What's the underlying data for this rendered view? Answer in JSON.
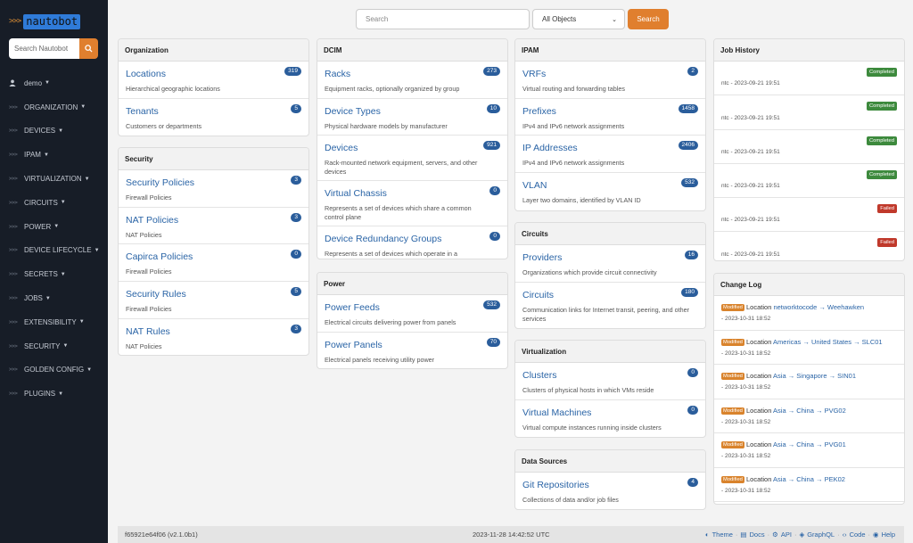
{
  "sidebar": {
    "logo": "nautobot",
    "logo_prefix": ">>>",
    "search_placeholder": "Search Nautobot",
    "user": "demo",
    "items": [
      {
        "label": "ORGANIZATION"
      },
      {
        "label": "DEVICES"
      },
      {
        "label": "IPAM"
      },
      {
        "label": "VIRTUALIZATION"
      },
      {
        "label": "CIRCUITS"
      },
      {
        "label": "POWER"
      },
      {
        "label": "DEVICE LIFECYCLE"
      },
      {
        "label": "SECRETS"
      },
      {
        "label": "JOBS"
      },
      {
        "label": "EXTENSIBILITY"
      },
      {
        "label": "SECURITY"
      },
      {
        "label": "GOLDEN CONFIG"
      },
      {
        "label": "PLUGINS"
      }
    ]
  },
  "search": {
    "placeholder": "Search",
    "scope": "All Objects",
    "button": "Search"
  },
  "organization": {
    "title": "Organization",
    "items": [
      {
        "name": "Locations",
        "desc": "Hierarchical geographic locations",
        "count": "319"
      },
      {
        "name": "Tenants",
        "desc": "Customers or departments",
        "count": "5"
      }
    ]
  },
  "security": {
    "title": "Security",
    "items": [
      {
        "name": "Security Policies",
        "desc": "Firewall Policies",
        "count": "3"
      },
      {
        "name": "NAT Policies",
        "desc": "NAT Policies",
        "count": "3"
      },
      {
        "name": "Capirca Policies",
        "desc": "Firewall Policies",
        "count": "0"
      },
      {
        "name": "Security Rules",
        "desc": "Firewall Policies",
        "count": "5"
      },
      {
        "name": "NAT Rules",
        "desc": "NAT Policies",
        "count": "3"
      }
    ]
  },
  "dcim": {
    "title": "DCIM",
    "items": [
      {
        "name": "Racks",
        "desc": "Equipment racks, optionally organized by group",
        "count": "273"
      },
      {
        "name": "Device Types",
        "desc": "Physical hardware models by manufacturer",
        "count": "10"
      },
      {
        "name": "Devices",
        "desc": "Rack-mounted network equipment, servers, and other devices",
        "count": "921"
      },
      {
        "name": "Virtual Chassis",
        "desc": "Represents a set of devices which share a common control plane",
        "count": "0"
      },
      {
        "name": "Device Redundancy Groups",
        "desc": "Represents a set of devices which operate in a",
        "count": "0"
      }
    ]
  },
  "power": {
    "title": "Power",
    "items": [
      {
        "name": "Power Feeds",
        "desc": "Electrical circuits delivering power from panels",
        "count": "532"
      },
      {
        "name": "Power Panels",
        "desc": "Electrical panels receiving utility power",
        "count": "70"
      }
    ]
  },
  "ipam": {
    "title": "IPAM",
    "items": [
      {
        "name": "VRFs",
        "desc": "Virtual routing and forwarding tables",
        "count": "2"
      },
      {
        "name": "Prefixes",
        "desc": "IPv4 and IPv6 network assignments",
        "count": "1458"
      },
      {
        "name": "IP Addresses",
        "desc": "IPv4 and IPv6 network assignments",
        "count": "2406"
      },
      {
        "name": "VLAN",
        "desc": "Layer two domains, identified by VLAN ID",
        "count": "532"
      }
    ]
  },
  "circuits": {
    "title": "Circuits",
    "items": [
      {
        "name": "Providers",
        "desc": "Organizations which provide circuit connectivity",
        "count": "16"
      },
      {
        "name": "Circuits",
        "desc": "Communication links for Internet transit, peering, and other services",
        "count": "180"
      }
    ]
  },
  "virtualization": {
    "title": "Virtualization",
    "items": [
      {
        "name": "Clusters",
        "desc": "Clusters of physical hosts in which VMs reside",
        "count": "0"
      },
      {
        "name": "Virtual Machines",
        "desc": "Virtual compute instances running inside clusters",
        "count": "0"
      }
    ]
  },
  "data_sources": {
    "title": "Data Sources",
    "items": [
      {
        "name": "Git Repositories",
        "desc": "Collections of data and/or job files",
        "count": "4"
      }
    ]
  },
  "job_history": {
    "title": "Job History",
    "items": [
      {
        "text": "ntc - 2023-09-21 19:51",
        "status": "Completed"
      },
      {
        "text": "ntc - 2023-09-21 19:51",
        "status": "Completed"
      },
      {
        "text": "ntc - 2023-09-21 19:51",
        "status": "Completed"
      },
      {
        "text": "ntc - 2023-09-21 19:51",
        "status": "Completed"
      },
      {
        "text": "ntc - 2023-09-21 19:51",
        "status": "Failed"
      },
      {
        "text": "ntc - 2023-09-21 19:51",
        "status": "Failed"
      }
    ]
  },
  "change_log": {
    "title": "Change Log",
    "items": [
      {
        "badge": "Modified",
        "obj": "Location",
        "path": "networktocode → Weehawken",
        "time": "- 2023-10-31 18:52"
      },
      {
        "badge": "Modified",
        "obj": "Location",
        "path": "Americas → United States → SLC01",
        "time": "- 2023-10-31 18:52"
      },
      {
        "badge": "Modified",
        "obj": "Location",
        "path": "Asia → Singapore → SIN01",
        "time": "- 2023-10-31 18:52"
      },
      {
        "badge": "Modified",
        "obj": "Location",
        "path": "Asia → China → PVG02",
        "time": "- 2023-10-31 18:52"
      },
      {
        "badge": "Modified",
        "obj": "Location",
        "path": "Asia → China → PVG01",
        "time": "- 2023-10-31 18:52"
      },
      {
        "badge": "Modified",
        "obj": "Location",
        "path": "Asia → China → PEK02",
        "time": "- 2023-10-31 18:52"
      }
    ]
  },
  "footer": {
    "version": "f65921e64f06 (v2.1.0b1)",
    "timestamp": "2023-11-28 14:42:52 UTC",
    "links": [
      "Theme",
      "Docs",
      "API",
      "GraphQL",
      "Code",
      "Help"
    ]
  },
  "colors": {
    "accent": "#e07f2e",
    "link": "#2a64a6",
    "sidebar_bg": "#171d27",
    "badge": "#2a5d9b",
    "success": "#3d8a3d",
    "danger": "#c0392b"
  }
}
